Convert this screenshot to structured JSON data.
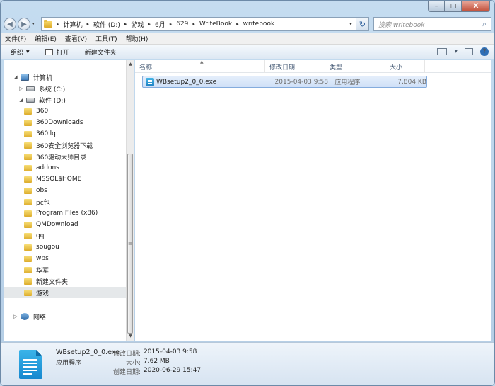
{
  "window": {
    "controls": {
      "minimize": "–",
      "maximize": "□",
      "close": "X"
    }
  },
  "address_bar": {
    "crumbs": [
      "计算机",
      "软件 (D:)",
      "游戏",
      "6月",
      "629",
      "WriteBook",
      "writebook"
    ],
    "dropdown_glyph": "▾",
    "refresh_glyph": "↻"
  },
  "search": {
    "placeholder": "搜索 writebook",
    "icon": "⌕"
  },
  "menu": [
    "文件(F)",
    "编辑(E)",
    "查看(V)",
    "工具(T)",
    "帮助(H)"
  ],
  "toolbar": {
    "organize": "组织",
    "open": "打开",
    "new_folder": "新建文件夹",
    "view_dropdown": "▾",
    "help": "?"
  },
  "nav": {
    "computer": "计算机",
    "drives": [
      "系统 (C:)",
      "软件 (D:)"
    ],
    "folders": [
      "360",
      "360Downloads",
      "360llq",
      "360安全浏览器下载",
      "360驱动大师目录",
      "addons",
      "MSSQL$HOME",
      "obs",
      "pc包",
      "Program Files (x86)",
      "QMDownload",
      "qq",
      "sougou",
      "wps",
      "华军",
      "新建文件夹",
      "游戏"
    ],
    "network": "网络",
    "selected": "游戏"
  },
  "columns": [
    "名称",
    "修改日期",
    "类型",
    "大小"
  ],
  "files": [
    {
      "name": "WBsetup2_0_0.exe",
      "modified": "2015-04-03 9:58",
      "type": "应用程序",
      "size": "7,804 KB"
    }
  ],
  "details": {
    "name": "WBsetup2_0_0.exe",
    "type": "应用程序",
    "modified_label": "修改日期:",
    "modified": "2015-04-03 9:58",
    "size_label": "大小:",
    "size": "7.62 MB",
    "created_label": "创建日期:",
    "created": "2020-06-29 15:47"
  },
  "colors": {
    "accent": "#3d7ab9",
    "selection": "#cfe0f7",
    "frame": "#bfd5ea"
  }
}
